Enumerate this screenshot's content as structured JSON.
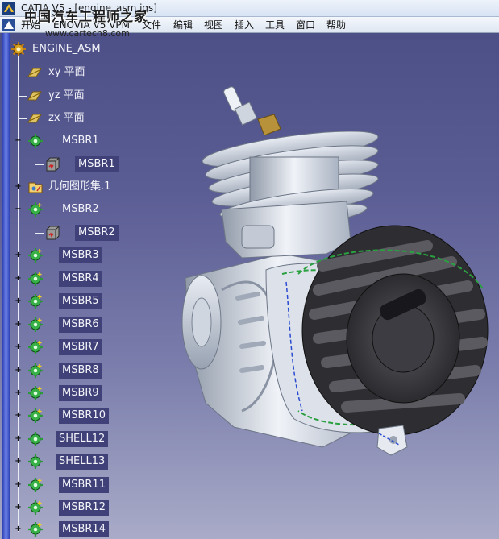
{
  "window": {
    "title": "CATIA V5 - [engine_asm.igs]",
    "watermark": "中国汽车工程师之家",
    "watermark_url": "www.cartech8.com"
  },
  "menu": [
    "开始",
    "ENOVIA V5 VPM",
    "文件",
    "编辑",
    "视图",
    "插入",
    "工具",
    "窗口",
    "帮助"
  ],
  "tree": {
    "root": "ENGINE_ASM",
    "planes": [
      "xy 平面",
      "yz 平面",
      "zx 平面"
    ],
    "msbr1": {
      "product": "MSBR1",
      "part": "MSBR1"
    },
    "geoset": "几何图形集.1",
    "msbr2": {
      "product": "MSBR2",
      "part": "MSBR2"
    },
    "products": [
      "MSBR3",
      "MSBR4",
      "MSBR5",
      "MSBR6",
      "MSBR7",
      "MSBR8",
      "MSBR9",
      "MSBR10",
      "SHELL12",
      "SHELL13",
      "MSBR11",
      "MSBR12",
      "MSBR14"
    ]
  },
  "icons": {
    "app": "catia-logo-icon",
    "root": "gear-product-icon",
    "plane": "plane-icon",
    "product": "gear-product-icon",
    "part": "part-body-icon",
    "geoset": "geometrical-set-icon"
  },
  "colors": {
    "background_top": "#4a4c84",
    "background_bottom": "#a9abc8",
    "tree_text": "#f4f4fa",
    "label_box": "#3f4178",
    "tree_rail": "#2d3fb3"
  }
}
